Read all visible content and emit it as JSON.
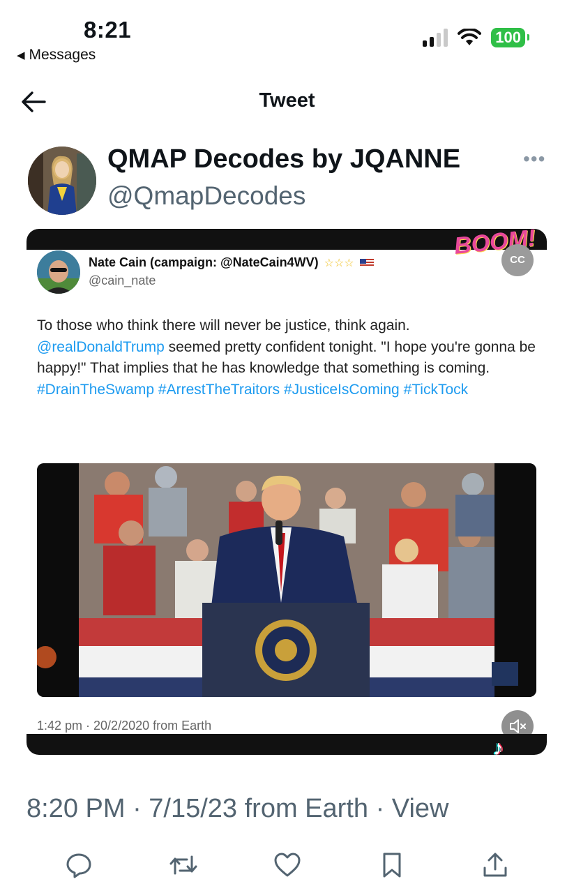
{
  "status_bar": {
    "time": "8:21",
    "back_label": "Messages",
    "battery": "100",
    "signal_bars_on": 2,
    "signal_bars_total": 4
  },
  "nav": {
    "title": "Tweet"
  },
  "tweet": {
    "author_name": "QMAP Decodes by JQANNE",
    "author_handle": "@QmapDecodes",
    "timestamp": "8:20 PM · 7/15/23 from Earth",
    "view_link": "View"
  },
  "embedded": {
    "badge": "BOOM!",
    "name": "Nate Cain (campaign: @NateCain4WV)",
    "handle": "@cain_nate",
    "text_1": "To those who think there will never be justice, think again.",
    "mention": "@realDonaldTrump",
    "text_2": " seemed pretty confident tonight. \"I hope you're gonna be happy!\" That implies that he has knowledge that something is coming.",
    "hashtags": "#DrainTheSwamp #ArrestTheTraitors #JusticeIsComing #TickTock",
    "timestamp": "1:42 pm · 20/2/2020 from Earth"
  },
  "media_controls": {
    "cc_label": "CC",
    "tiktok_mark": "♪"
  },
  "colors": {
    "link": "#1d9bf0",
    "secondary_text": "#536471",
    "battery": "#2fbf47"
  }
}
